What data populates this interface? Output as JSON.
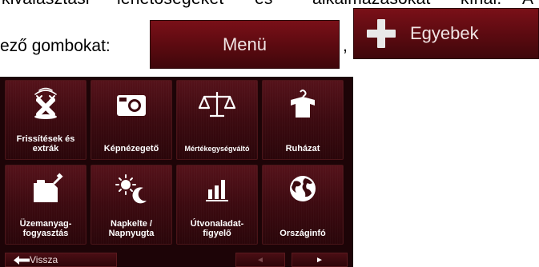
{
  "document": {
    "line1_words": [
      "kiválasztási",
      "lehetőségeket",
      "és",
      "alkalmazásokat",
      "kínál.",
      "A"
    ],
    "line2_prefix": "ező gombokat:",
    "comma": ",",
    "menu_button_label": "Menü",
    "more_button_label": "Egyebek"
  },
  "screen": {
    "tiles": [
      {
        "label": "Frissítések és extrák",
        "icon": "updates-extras-icon"
      },
      {
        "label": "Képnézegető",
        "icon": "camera-icon"
      },
      {
        "label": "Mértékegységváltó",
        "icon": "scales-icon"
      },
      {
        "label": "Ruházat",
        "icon": "shirt-icon"
      },
      {
        "label": "Üzemanyag-fogyasztás",
        "icon": "fuel-can-icon"
      },
      {
        "label": "Napkelte / Napnyugta",
        "icon": "sun-moon-icon"
      },
      {
        "label": "Útvonaladat-figyelő",
        "icon": "bar-chart-icon"
      },
      {
        "label": "Országinfó",
        "icon": "globe-icon"
      }
    ],
    "back_label": "Vissza",
    "prev_glyph": "◄",
    "next_glyph": "►"
  }
}
